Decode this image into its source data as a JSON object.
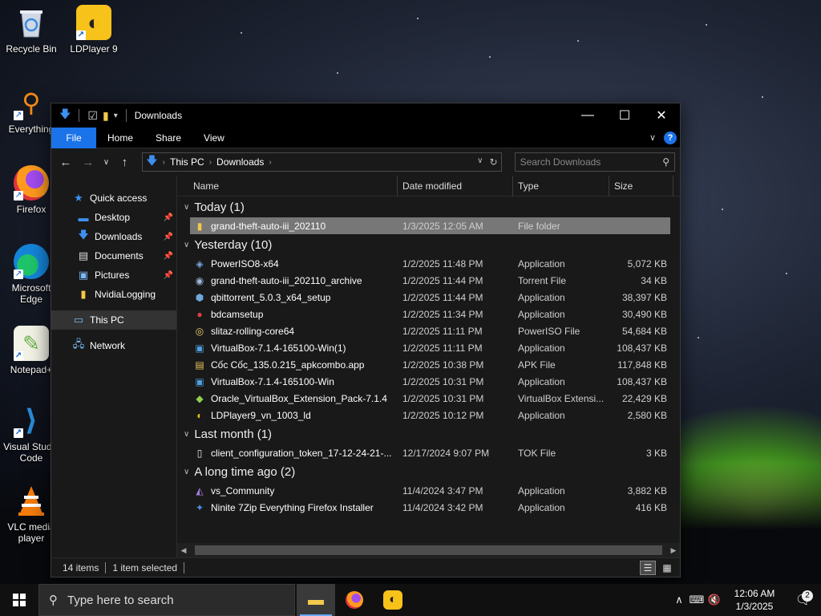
{
  "desktop": {
    "icons": [
      {
        "label": "Recycle Bin",
        "icon": "recycle-bin-icon"
      },
      {
        "label": "LDPlayer 9",
        "icon": "ldplayer-icon"
      },
      {
        "label": "Everything",
        "icon": "everything-search-icon"
      },
      {
        "label": "Firefox",
        "icon": "firefox-icon"
      },
      {
        "label": "Microsoft Edge",
        "icon": "edge-icon"
      },
      {
        "label": "Notepad+",
        "icon": "notepad-plus-icon"
      },
      {
        "label": "Visual Studio Code",
        "icon": "vscode-icon"
      },
      {
        "label": "VLC media player",
        "icon": "vlc-icon"
      }
    ]
  },
  "window": {
    "title": "Downloads",
    "controls": {
      "minimize": "—",
      "maximize": "☐",
      "close": "✕"
    },
    "ribbon_tabs": [
      "File",
      "Home",
      "Share",
      "View"
    ],
    "help": "?",
    "address": {
      "segments": [
        "This PC",
        "Downloads"
      ]
    },
    "search_placeholder": "Search Downloads",
    "sidebar": {
      "quick_access": "Quick access",
      "items": [
        {
          "label": "Desktop",
          "pinned": true
        },
        {
          "label": "Downloads",
          "pinned": true
        },
        {
          "label": "Documents",
          "pinned": true
        },
        {
          "label": "Pictures",
          "pinned": true
        },
        {
          "label": "NvidiaLogging",
          "pinned": false
        }
      ],
      "this_pc": "This PC",
      "network": "Network"
    },
    "columns": {
      "name": "Name",
      "date": "Date modified",
      "type": "Type",
      "size": "Size"
    },
    "groups": [
      {
        "title": "Today (1)",
        "files": [
          {
            "name": "grand-theft-auto-iii_202110",
            "date": "1/3/2025 12:05 AM",
            "type": "File folder",
            "size": "",
            "icon": "folder-icon",
            "selected": true
          }
        ]
      },
      {
        "title": "Yesterday (10)",
        "files": [
          {
            "name": "PowerISO8-x64",
            "date": "1/2/2025 11:48 PM",
            "type": "Application",
            "size": "5,072 KB",
            "icon": "poweriso-installer-icon"
          },
          {
            "name": "grand-theft-auto-iii_202110_archive",
            "date": "1/2/2025 11:44 PM",
            "type": "Torrent File",
            "size": "34 KB",
            "icon": "torrent-file-icon"
          },
          {
            "name": "qbittorrent_5.0.3_x64_setup",
            "date": "1/2/2025 11:44 PM",
            "type": "Application",
            "size": "38,397 KB",
            "icon": "qbittorrent-icon"
          },
          {
            "name": "bdcamsetup",
            "date": "1/2/2025 11:34 PM",
            "type": "Application",
            "size": "30,490 KB",
            "icon": "bandicam-icon"
          },
          {
            "name": "slitaz-rolling-core64",
            "date": "1/2/2025 11:11 PM",
            "type": "PowerISO File",
            "size": "54,684 KB",
            "icon": "disc-image-icon"
          },
          {
            "name": "VirtualBox-7.1.4-165100-Win(1)",
            "date": "1/2/2025 11:11 PM",
            "type": "Application",
            "size": "108,437 KB",
            "icon": "virtualbox-icon"
          },
          {
            "name": "Cốc Cốc_135.0.215_apkcombo.app",
            "date": "1/2/2025 10:38 PM",
            "type": "APK File",
            "size": "117,848 KB",
            "icon": "apk-file-icon"
          },
          {
            "name": "VirtualBox-7.1.4-165100-Win",
            "date": "1/2/2025 10:31 PM",
            "type": "Application",
            "size": "108,437 KB",
            "icon": "virtualbox-icon"
          },
          {
            "name": "Oracle_VirtualBox_Extension_Pack-7.1.4",
            "date": "1/2/2025 10:31 PM",
            "type": "VirtualBox Extensi...",
            "size": "22,429 KB",
            "icon": "extension-pack-icon"
          },
          {
            "name": "LDPlayer9_vn_1003_ld",
            "date": "1/2/2025 10:12 PM",
            "type": "Application",
            "size": "2,580 KB",
            "icon": "ldplayer-icon"
          }
        ]
      },
      {
        "title": "Last month (1)",
        "files": [
          {
            "name": "client_configuration_token_17-12-24-21-...",
            "date": "12/17/2024 9:07 PM",
            "type": "TOK File",
            "size": "3 KB",
            "icon": "blank-file-icon"
          }
        ]
      },
      {
        "title": "A long time ago (2)",
        "files": [
          {
            "name": "vs_Community",
            "date": "11/4/2024 3:47 PM",
            "type": "Application",
            "size": "3,882 KB",
            "icon": "visual-studio-icon"
          },
          {
            "name": "Ninite 7Zip Everything Firefox Installer",
            "date": "11/4/2024 3:42 PM",
            "type": "Application",
            "size": "416 KB",
            "icon": "ninite-icon"
          }
        ]
      }
    ],
    "status": {
      "count": "14 items",
      "selected": "1 item selected"
    }
  },
  "taskbar": {
    "search_placeholder": "Type here to search",
    "apps": [
      "file-explorer-icon",
      "firefox-icon",
      "ldplayer-icon"
    ],
    "time": "12:06 AM",
    "date": "1/3/2025",
    "notifications": "2"
  }
}
